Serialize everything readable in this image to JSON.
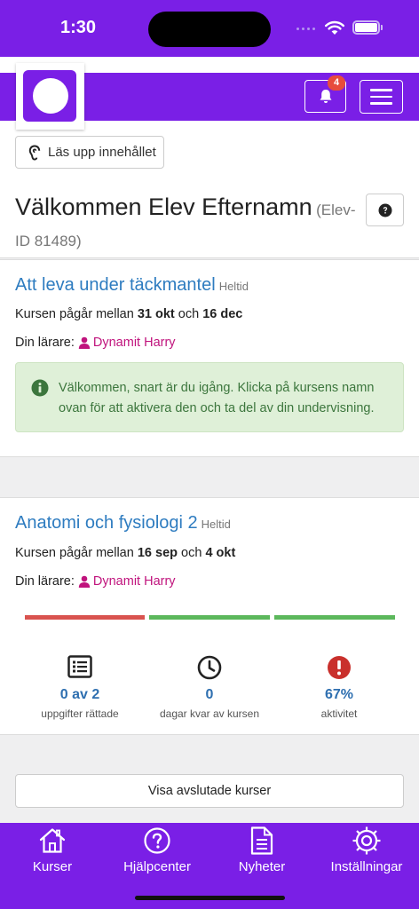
{
  "status_bar": {
    "time": "1:30"
  },
  "header": {
    "notification_count": "4",
    "unlock_label": "Läs upp innehållet"
  },
  "welcome": {
    "name": "Välkommen Elev Efternamn",
    "student_id": "(Elev-ID 81489)"
  },
  "courses": [
    {
      "title": "Att leva under täckmantel",
      "tag": "Heltid",
      "dates_prefix": "Kursen pågår mellan",
      "start": "31 okt",
      "between": "och",
      "end": "16 dec",
      "teacher_label": "Din lärare:",
      "teacher": "Dynamit Harry",
      "alert": "Välkommen, snart är du igång. Klicka på kursens namn ovan för att aktivera den och ta del av din undervisning."
    },
    {
      "title": "Anatomi och fysiologi 2",
      "tag": "Heltid",
      "dates_prefix": "Kursen pågår mellan",
      "start": "16 sep",
      "between": "och",
      "end": "4 okt",
      "teacher_label": "Din lärare:",
      "teacher": "Dynamit Harry",
      "progress_segments": [
        {
          "color": "#d9534f",
          "status": "behind"
        },
        {
          "color": "#5cb85c",
          "status": "ok"
        },
        {
          "color": "#5cb85c",
          "status": "ok"
        }
      ],
      "stats": [
        {
          "icon": "list-icon",
          "value": "0 av 2",
          "label": "uppgifter rättade"
        },
        {
          "icon": "clock-icon",
          "value": "0",
          "label": "dagar kvar av kursen"
        },
        {
          "icon": "alert-circle-icon",
          "value": "67%",
          "label": "aktivitet"
        }
      ]
    }
  ],
  "closed_courses_button": "Visa avslutade kurser",
  "tabbar": [
    {
      "icon": "home-icon",
      "label": "Kurser"
    },
    {
      "icon": "help-circle-icon",
      "label": "Hjälpcenter"
    },
    {
      "icon": "document-icon",
      "label": "Nyheter"
    },
    {
      "icon": "gear-icon",
      "label": "Inställningar"
    }
  ],
  "colors": {
    "brand": "#7a1fe6",
    "link": "#2e7cc0",
    "teacher": "#c0147d",
    "alert_bg": "#dff0d8",
    "danger": "#d9534f",
    "success": "#5cb85c"
  }
}
